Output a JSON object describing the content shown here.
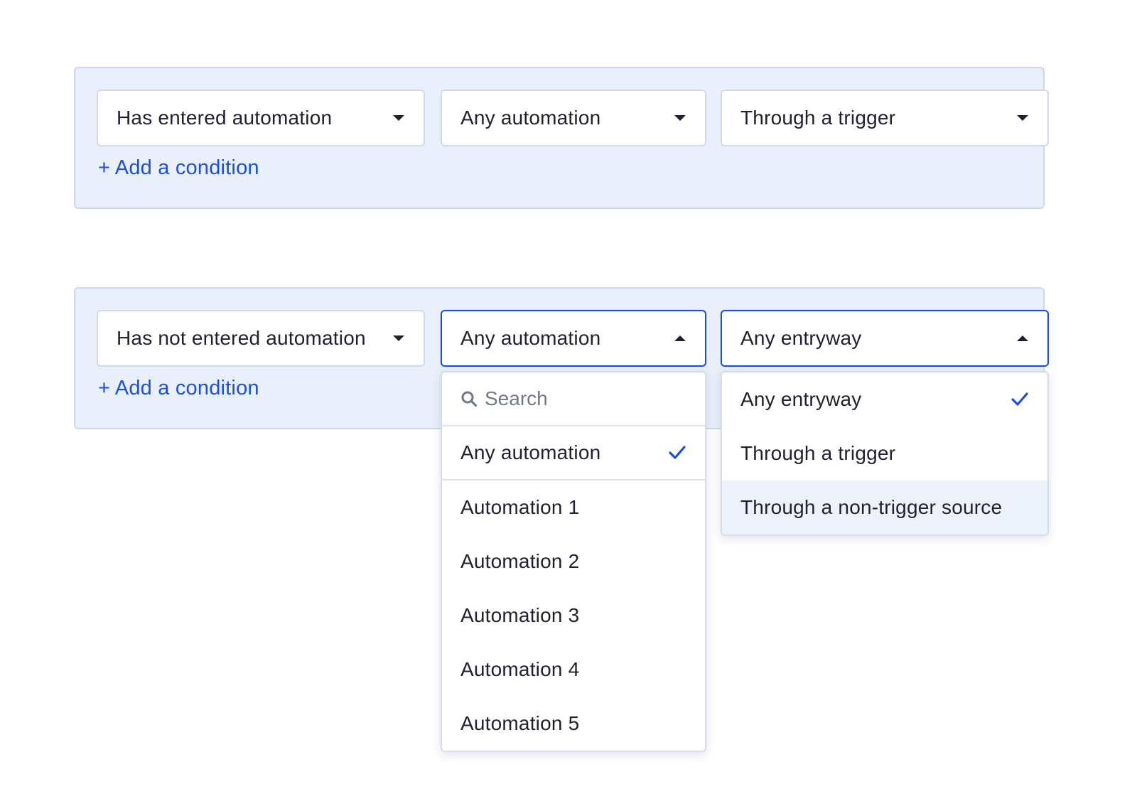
{
  "panels": [
    {
      "condition_select": "Has entered automation",
      "automation_select": "Any automation",
      "entryway_select": "Through a trigger",
      "add_condition": "+ Add a condition"
    },
    {
      "condition_select": "Has not entered automation",
      "automation_select": "Any automation",
      "entryway_select": "Any entryway",
      "add_condition": "+ Add a condition"
    }
  ],
  "automation_menu": {
    "search_placeholder": "Search",
    "selected": "Any automation",
    "options": [
      "Automation 1",
      "Automation 2",
      "Automation 3",
      "Automation 4",
      "Automation 5"
    ]
  },
  "entryway_menu": {
    "options": [
      "Any entryway",
      "Through a trigger",
      "Through a non-trigger source"
    ],
    "selected": "Any entryway",
    "hovered": "Through a non-trigger source"
  },
  "colors": {
    "accent": "#1a4fe0",
    "panel_bg": "#e9effb",
    "panel_border": "#cfd8ea",
    "text": "#1f2130",
    "hover_bg": "#eef2fb"
  },
  "icons": {
    "caret_closed": "caret-down-icon",
    "caret_open": "caret-up-icon",
    "search": "search-icon",
    "check": "checkmark-icon"
  }
}
